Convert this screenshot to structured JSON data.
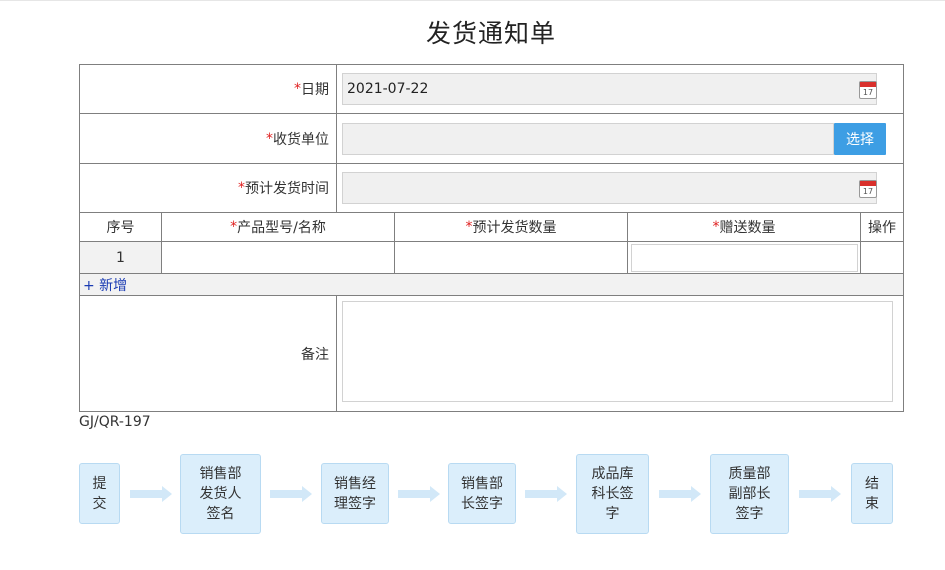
{
  "title": "发货通知单",
  "form": {
    "date": {
      "required_mark": "*",
      "label": "日期",
      "value": "2021-07-22",
      "calendar_day": "17"
    },
    "receiver": {
      "required_mark": "*",
      "label": "收货单位",
      "value": "",
      "select_label": "选择"
    },
    "ship_time": {
      "required_mark": "*",
      "label": "预计发货时间",
      "value": "",
      "calendar_day": "17"
    },
    "table": {
      "columns": [
        {
          "required_mark": "",
          "label": "序号"
        },
        {
          "required_mark": "*",
          "label": "产品型号/名称"
        },
        {
          "required_mark": "*",
          "label": "预计发货数量"
        },
        {
          "required_mark": "*",
          "label": "赠送数量"
        },
        {
          "required_mark": "",
          "label": "操作"
        }
      ],
      "rows": [
        {
          "index": "1",
          "product": "",
          "qty": "",
          "gift": "",
          "ops": ""
        }
      ]
    },
    "add_label": "+ 新增",
    "remark": {
      "label": "备注",
      "value": ""
    }
  },
  "doc_code": "GJ/QR-197",
  "workflow": {
    "steps": [
      "提交",
      "销售部发货人签名",
      "销售经理签字",
      "销售部长签字",
      "成品库科长签字",
      "质量部副部长签字",
      "结束"
    ]
  },
  "colors": {
    "accent": "#3d9ee4",
    "required": "#e02020",
    "step_bg": "#dbeefb",
    "arrow": "#d2e8f8"
  }
}
